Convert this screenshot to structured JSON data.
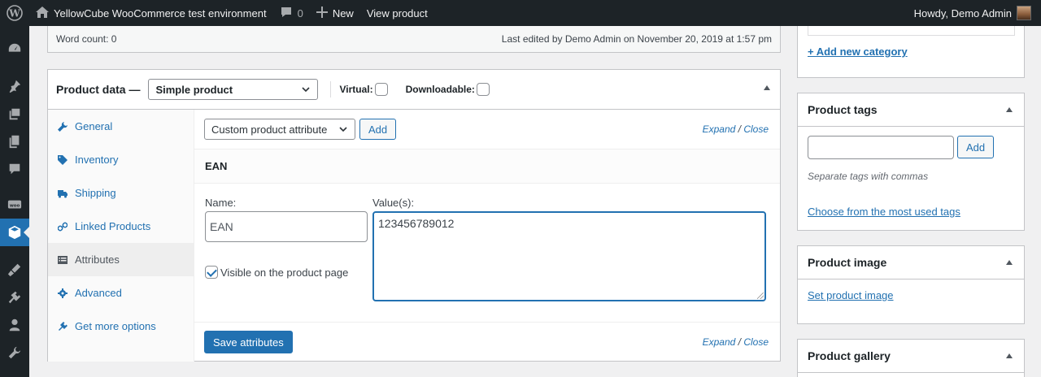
{
  "adminbar": {
    "site_name": "YellowCube WooCommerce test environment",
    "comments_count": "0",
    "new_label": "New",
    "view_product_label": "View product",
    "howdy": "Howdy, Demo Admin"
  },
  "editor_footer": {
    "word_count": "Word count: 0",
    "last_edited": "Last edited by Demo Admin on November 20, 2019 at 1:57 pm"
  },
  "product_data": {
    "title": "Product data —",
    "product_type": "Simple product",
    "virtual_label": "Virtual:",
    "downloadable_label": "Downloadable:",
    "tabs": [
      {
        "label": "General"
      },
      {
        "label": "Inventory"
      },
      {
        "label": "Shipping"
      },
      {
        "label": "Linked Products"
      },
      {
        "label": "Attributes"
      },
      {
        "label": "Advanced"
      },
      {
        "label": "Get more options"
      }
    ],
    "attributes": {
      "attribute_select": "Custom product attribute",
      "add_label": "Add",
      "expand": "Expand",
      "slash": " / ",
      "close": "Close",
      "attribute_name_heading": "EAN",
      "name_label": "Name:",
      "name_value": "EAN",
      "values_label": "Value(s):",
      "values_value": "123456789012",
      "visible_label": "Visible on the product page",
      "visible_checked": true,
      "save_label": "Save attributes"
    }
  },
  "sidebar": {
    "add_new_category": "+ Add new category",
    "tags": {
      "title": "Product tags",
      "add_label": "Add",
      "hint": "Separate tags with commas",
      "choose_link": "Choose from the most used tags"
    },
    "image": {
      "title": "Product image",
      "set_link": "Set product image"
    },
    "gallery": {
      "title": "Product gallery"
    }
  },
  "colors": {
    "accent": "#2271b1",
    "adminbar_bg": "#1d2327",
    "page_bg": "#f0f0f1"
  }
}
